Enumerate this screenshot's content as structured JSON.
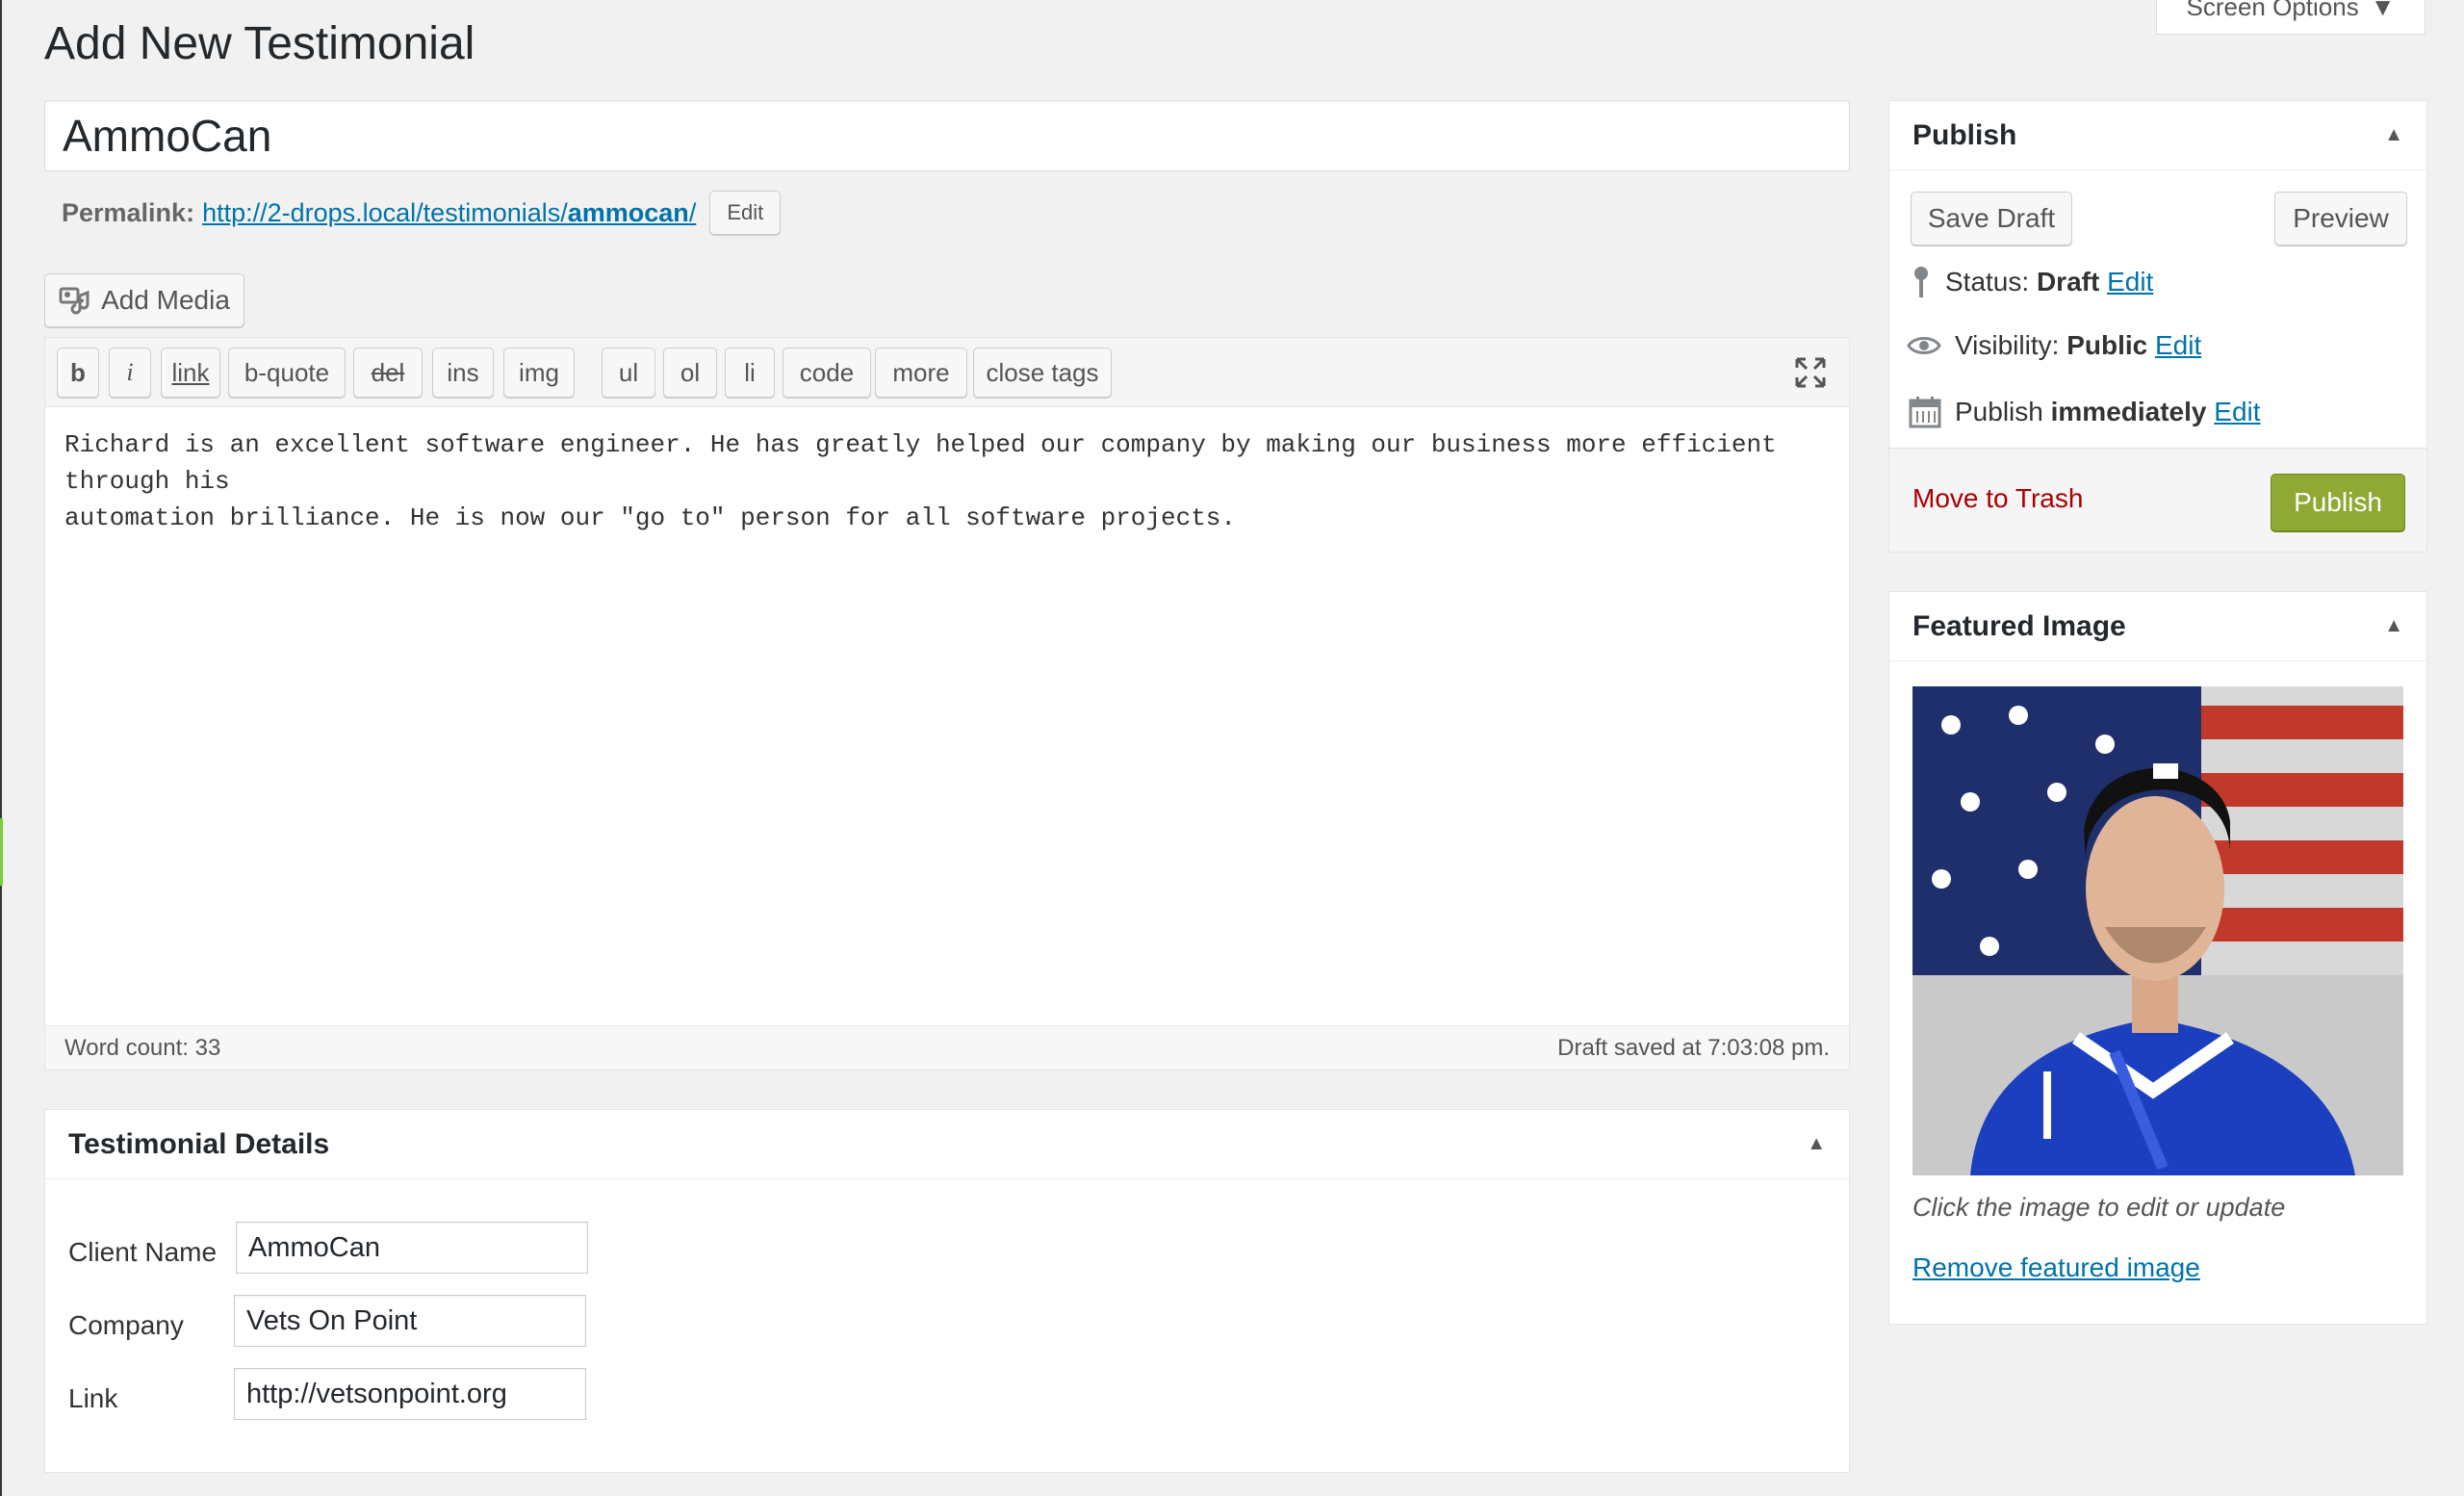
{
  "page": {
    "title": "Add New Testimonial",
    "screen_options": "Screen Options"
  },
  "post": {
    "title": "AmmoCan",
    "permalink_label": "Permalink:",
    "permalink_base": "http://2-drops.local/testimonials/",
    "permalink_slug": "ammocan",
    "permalink_trailing": "/",
    "permalink_edit": "Edit"
  },
  "editor": {
    "add_media": "Add Media",
    "buttons": [
      "b",
      "i",
      "link",
      "b-quote",
      "del",
      "ins",
      "img",
      "ul",
      "ol",
      "li",
      "code",
      "more",
      "close tags"
    ],
    "content": "Richard is an excellent software engineer. He has greatly helped our company by making our business more efficient through his\nautomation brilliance. He is now our \"go to\" person for all software projects.",
    "word_count": "Word count: 33",
    "draft_saved": "Draft saved at 7:03:08 pm."
  },
  "testimonial_details": {
    "title": "Testimonial Details",
    "fields": [
      {
        "label": "Client Name",
        "value": "AmmoCan"
      },
      {
        "label": "Company",
        "value": "Vets On Point"
      },
      {
        "label": "Link",
        "value": "http://vetsonpoint.org"
      }
    ]
  },
  "publish": {
    "title": "Publish",
    "save_draft": "Save Draft",
    "preview": "Preview",
    "status_label": "Status:",
    "status_value": "Draft",
    "visibility_label": "Visibility:",
    "visibility_value": "Public",
    "schedule_label": "Publish",
    "schedule_value": "immediately",
    "edit": "Edit",
    "move_to_trash": "Move to Trash",
    "publish_button": "Publish"
  },
  "featured_image": {
    "title": "Featured Image",
    "caption": "Click the image to edit or update",
    "remove": "Remove featured image"
  },
  "colors": {
    "accent_link": "#0073aa",
    "publish_green": "#8fa934",
    "trash_red": "#a00"
  }
}
